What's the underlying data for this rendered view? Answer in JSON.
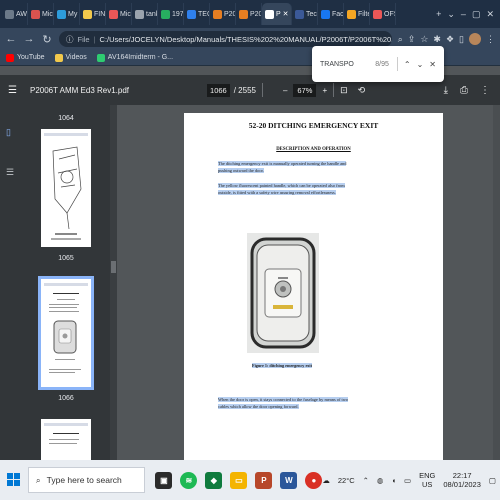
{
  "browser": {
    "tabs": [
      {
        "label": "AWC",
        "color": "#6c7a89"
      },
      {
        "label": "Micr",
        "color": "#d9534f"
      },
      {
        "label": "My F",
        "color": "#2d9cdb"
      },
      {
        "label": "FINA",
        "color": "#f2c94c"
      },
      {
        "label": "Micr",
        "color": "#eb5757"
      },
      {
        "label": "tank",
        "color": "#9aa3ad"
      },
      {
        "label": "1970",
        "color": "#27ae60"
      },
      {
        "label": "TECI",
        "color": "#2f80ed"
      },
      {
        "label": "P200",
        "color": "#e67e22"
      },
      {
        "label": "P200",
        "color": "#e67e22"
      },
      {
        "label": "P",
        "color": "#ffffff",
        "active": true
      },
      {
        "label": "Tecn",
        "color": "#3b5998"
      },
      {
        "label": "Face",
        "color": "#1877f2"
      },
      {
        "label": "Filtei",
        "color": "#f5a623"
      },
      {
        "label": "OFS",
        "color": "#eb5757"
      }
    ],
    "url_scheme": "File",
    "url": "C:/Users/JOCELYN/Desktop/Manuals/THESIS%202%20MANUAL/P2006T/P2006T%20AMM%20Ed3%20Rev1.pdf",
    "bookmarks": [
      {
        "label": "YouTube",
        "color": "#ff0000"
      },
      {
        "label": "Videos",
        "color": "#f2c94c"
      },
      {
        "label": "AV164Imidterm - G...",
        "color": "#2ecc71"
      }
    ]
  },
  "find": {
    "query": "TRANSPO",
    "count": "8/95"
  },
  "pdf": {
    "title": "P2006T AMM Ed3 Rev1.pdf",
    "current_page": "1066",
    "total_pages": "/ 2555",
    "zoom": "67%"
  },
  "thumbnails": [
    {
      "label": "1064"
    },
    {
      "label": "1065"
    },
    {
      "label": "1066"
    }
  ],
  "page": {
    "title": "52-20 DITCHING EMERGENCY EXIT",
    "section": "DESCRIPTION AND OPERATION",
    "para1": "The ditching emergency exit is manually operated turning the handle and pushing outward the door.",
    "para2": "The yellow fluorescent painted handle, which can be operated also from outside, is fitted with a safety wire assuring removal effortlessness.",
    "caption": "Figure 1: ditching emergency exit",
    "para3": "When the door is open, it stays connected to the fuselage by means of two cables which allow the door opening forward."
  },
  "taskbar": {
    "search_placeholder": "Type here to search",
    "weather": "22°C",
    "lang_top": "ENG",
    "lang_bottom": "US",
    "time": "22:17",
    "date": "08/01/2023"
  }
}
